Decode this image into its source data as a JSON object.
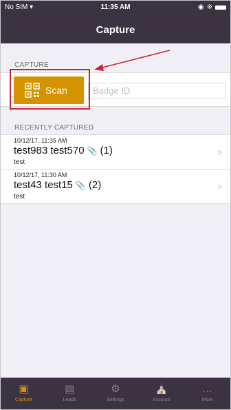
{
  "status": {
    "carrier": "No SIM ▾",
    "time": "11:35 AM"
  },
  "nav": {
    "title": "Capture"
  },
  "capture": {
    "section_label": "CAPTURE",
    "scan_label": "Scan",
    "badge_placeholder": "Badge ID"
  },
  "recent": {
    "section_label": "RECENTLY CAPTURED",
    "items": [
      {
        "timestamp": "10/12/17, 11:35 AM",
        "name": "test983 test570",
        "count": "(1)",
        "note": "test"
      },
      {
        "timestamp": "10/12/17, 11:30 AM",
        "name": "test43 test15",
        "count": "(2)",
        "note": "test"
      }
    ]
  },
  "tabs": [
    {
      "label": "Capture",
      "icon": "capture-icon"
    },
    {
      "label": "Leads",
      "icon": "leads-icon"
    },
    {
      "label": "Settings",
      "icon": "gear-icon"
    },
    {
      "label": "Account",
      "icon": "bank-icon"
    },
    {
      "label": "More",
      "icon": "more-icon"
    }
  ],
  "colors": {
    "accent": "#d59300",
    "bar": "#3b3242",
    "highlight": "#cc2233"
  }
}
